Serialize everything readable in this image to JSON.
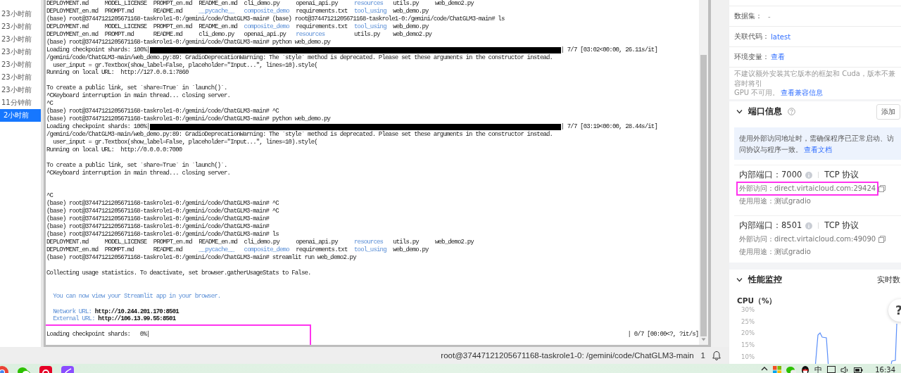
{
  "history": [
    {
      "label": "23小时前",
      "selected": false
    },
    {
      "label": "23小时前",
      "selected": false
    },
    {
      "label": "23小时前",
      "selected": false
    },
    {
      "label": "23小时前",
      "selected": false
    },
    {
      "label": "23小时前",
      "selected": false
    },
    {
      "label": "23小时前",
      "selected": false
    },
    {
      "label": "23小时前",
      "selected": false
    },
    {
      "label": "11分钟前",
      "selected": false
    },
    {
      "label": "2小时前",
      "selected": true
    }
  ],
  "terminal": {
    "lines": [
      {
        "kind": "ls",
        "entries": [
          {
            "name": "DEPLOYMENT.md",
            "kind": "file"
          },
          {
            "name": "MODEL_LICENSE",
            "kind": "file"
          },
          {
            "name": "PROMPT_en.md",
            "kind": "file"
          },
          {
            "name": "README_en.md",
            "kind": "file"
          },
          {
            "name": "cli_demo.py",
            "kind": "file"
          },
          {
            "name": "openai_api.py",
            "kind": "file"
          },
          {
            "name": "resources",
            "kind": "dir"
          },
          {
            "name": "utils.py",
            "kind": "file"
          },
          {
            "name": "web_demo2.py",
            "kind": "file"
          }
        ]
      },
      {
        "kind": "ls",
        "entries": [
          {
            "name": "DEPLOYMENT_en.md",
            "kind": "file"
          },
          {
            "name": "PROMPT.md",
            "kind": "file"
          },
          {
            "name": "README.md",
            "kind": "file"
          },
          {
            "name": "__pycache__",
            "kind": "dir"
          },
          {
            "name": "composite_demo",
            "kind": "dir"
          },
          {
            "name": "requirements.txt",
            "kind": "file"
          },
          {
            "name": "tool_using",
            "kind": "dir"
          },
          {
            "name": "web_demo.py",
            "kind": "file"
          }
        ]
      },
      {
        "kind": "text",
        "text": "(base) root@37447121205671168-taskrole1-0:/gemini/code/ChatGLM3-main# (base) root@37447121205671168-taskrole1-0:/gemini/code/ChatGLM3-main# ls"
      },
      {
        "kind": "ls",
        "entries": [
          {
            "name": "DEPLOYMENT.md",
            "kind": "file"
          },
          {
            "name": "MODEL_LICENSE",
            "kind": "file"
          },
          {
            "name": "PROMPT_en.md",
            "kind": "file"
          },
          {
            "name": "README_en.md",
            "kind": "file"
          },
          {
            "name": "composite_demo",
            "kind": "dir"
          },
          {
            "name": "requirements.txt",
            "kind": "file"
          },
          {
            "name": "tool_using",
            "kind": "dir"
          },
          {
            "name": "web_demo.py",
            "kind": "file"
          }
        ]
      },
      {
        "kind": "ls",
        "entries": [
          {
            "name": "DEPLOYMENT_en.md",
            "kind": "file"
          },
          {
            "name": "PROMPT.md",
            "kind": "file"
          },
          {
            "name": "README.md",
            "kind": "file"
          },
          {
            "name": "cli_demo.py",
            "kind": "file"
          },
          {
            "name": "openai_api.py",
            "kind": "file"
          },
          {
            "name": "resources",
            "kind": "dir"
          },
          {
            "name": "utils.py",
            "kind": "file"
          },
          {
            "name": "web_demo2.py",
            "kind": "file"
          }
        ]
      },
      {
        "kind": "text",
        "text": "(base) root@37447121205671168-taskrole1-0:/gemini/code/ChatGLM3-main# python web_demo.py"
      },
      {
        "kind": "progress",
        "label": "Loading checkpoint shards: 100%|",
        "level": 1,
        "stats": "| 7/7 [03:02<00:00, 26.11s/it]",
        "highlighted": false
      },
      {
        "kind": "text",
        "text": "/gemini/code/ChatGLM3-main/web_demo.py:89: GradioDeprecationWarning: The `style` method is deprecated. Please set these arguments in the constructor instead."
      },
      {
        "kind": "indented",
        "text": "user_input = gr.Textbox(show_label=False, placeholder=\"Input...\", lines=10).style("
      },
      {
        "kind": "text",
        "text": "Running on local URL:  http://127.0.0.1:7860"
      },
      {
        "kind": "blank"
      },
      {
        "kind": "text",
        "text": "To create a public link, set `share=True` in `launch()`."
      },
      {
        "kind": "text",
        "text": "^CKeyboard interruption in main thread... closing server."
      },
      {
        "kind": "text",
        "text": "^C"
      },
      {
        "kind": "text",
        "text": "(base) root@37447121205671168-taskrole1-0:/gemini/code/ChatGLM3-main# ^C"
      },
      {
        "kind": "text",
        "text": "(base) root@37447121205671168-taskrole1-0:/gemini/code/ChatGLM3-main# python web_demo.py"
      },
      {
        "kind": "progress",
        "label": "Loading checkpoint shards: 100%|",
        "level": 1,
        "stats": "| 7/7 [03:19<00:00, 28.44s/it]",
        "highlighted": false
      },
      {
        "kind": "text",
        "text": "/gemini/code/ChatGLM3-main/web_demo.py:89: GradioDeprecationWarning: The `style` method is deprecated. Please set these arguments in the constructor instead."
      },
      {
        "kind": "indented",
        "text": "user_input = gr.Textbox(show_label=False, placeholder=\"Input...\", lines=10).style("
      },
      {
        "kind": "text",
        "text": "Running on local URL:  http://0.0.0.0:7000"
      },
      {
        "kind": "blank"
      },
      {
        "kind": "text",
        "text": "To create a public link, set `share=True` in `launch()`."
      },
      {
        "kind": "text",
        "text": "^CKeyboard interruption in main thread... closing server."
      },
      {
        "kind": "blank"
      },
      {
        "kind": "blank"
      },
      {
        "kind": "text",
        "text": "^C"
      },
      {
        "kind": "text",
        "text": "(base) root@37447121205671168-taskrole1-0:/gemini/code/ChatGLM3-main# ^C"
      },
      {
        "kind": "text",
        "text": "(base) root@37447121205671168-taskrole1-0:/gemini/code/ChatGLM3-main# ^C"
      },
      {
        "kind": "text",
        "text": "(base) root@37447121205671168-taskrole1-0:/gemini/code/ChatGLM3-main#"
      },
      {
        "kind": "text",
        "text": "(base) root@37447121205671168-taskrole1-0:/gemini/code/ChatGLM3-main#"
      },
      {
        "kind": "text",
        "text": "(base) root@37447121205671168-taskrole1-0:/gemini/code/ChatGLM3-main# ls"
      },
      {
        "kind": "ls",
        "entries": [
          {
            "name": "DEPLOYMENT.md",
            "kind": "file"
          },
          {
            "name": "MODEL_LICENSE",
            "kind": "file"
          },
          {
            "name": "PROMPT_en.md",
            "kind": "file"
          },
          {
            "name": "README_en.md",
            "kind": "file"
          },
          {
            "name": "cli_demo.py",
            "kind": "file"
          },
          {
            "name": "openai_api.py",
            "kind": "file"
          },
          {
            "name": "resources",
            "kind": "dir"
          },
          {
            "name": "utils.py",
            "kind": "file"
          },
          {
            "name": "web_demo2.py",
            "kind": "file"
          }
        ]
      },
      {
        "kind": "ls",
        "entries": [
          {
            "name": "DEPLOYMENT_en.md",
            "kind": "file"
          },
          {
            "name": "PROMPT.md",
            "kind": "file"
          },
          {
            "name": "README.md",
            "kind": "file"
          },
          {
            "name": "__pycache__",
            "kind": "dir"
          },
          {
            "name": "composite_demo",
            "kind": "dir"
          },
          {
            "name": "requirements.txt",
            "kind": "file"
          },
          {
            "name": "tool_using",
            "kind": "dir"
          },
          {
            "name": "web_demo.py",
            "kind": "file"
          }
        ]
      },
      {
        "kind": "text",
        "text": "(base) root@37447121205671168-taskrole1-0:/gemini/code/ChatGLM3-main# streamlit run web_demo2.py"
      },
      {
        "kind": "blank"
      },
      {
        "kind": "text",
        "text": "Collecting usage statistics. To deactivate, set browser.gatherUsageStats to False."
      },
      {
        "kind": "blank"
      },
      {
        "kind": "blank"
      },
      {
        "kind": "notice",
        "text": "You can now view your Streamlit app in your browser."
      },
      {
        "kind": "blank"
      },
      {
        "kind": "url",
        "label": "Network URL:",
        "url": "http://10.244.201.170:8501"
      },
      {
        "kind": "url",
        "label": "External URL:",
        "url": "http://106.13.99.55:8501"
      },
      {
        "kind": "blank"
      },
      {
        "kind": "progress",
        "label": "Loading checkpoint shards:   0%|",
        "level": 0,
        "stats": "| 0/7 [00:00<?, ?it/s]",
        "highlighted": true
      }
    ]
  },
  "status_bar": {
    "text": "root@37447121205671168-taskrole1-0: /gemini/code/ChatGLM3-main",
    "count": "1"
  },
  "panel": {
    "fields": [
      {
        "label": "数据集：",
        "value": "-",
        "kind": "plain"
      },
      {
        "label": "关联代码：",
        "value": "latest",
        "kind": "link"
      },
      {
        "label": "环境变量：",
        "value": "查看",
        "kind": "link"
      }
    ],
    "note": {
      "lines": [
        "不建议额外安装其它版本的框架和 Cuda，版本不兼容时将引",
        "GPU 不可用。"
      ],
      "link": "查看兼容信息"
    },
    "ports_section": {
      "title": "端口信息",
      "expanded": true,
      "add_button": "添加",
      "notice": "使用外部访问地址时，需确保程序已正常启动、访问协议与程序一致。",
      "notice_link": "查看文档",
      "ports": [
        {
          "internal_label": "内部端口：",
          "port": "7000",
          "protocol": "TCP 协议",
          "external_label": "外部访问：",
          "external": "direct.virtaicloud.com:29424",
          "usage_label": "使用用途：",
          "usage": "测试gradio",
          "highlighted": true
        },
        {
          "internal_label": "内部端口：",
          "port": "8501",
          "protocol": "TCP 协议",
          "external_label": "外部访问：",
          "external": "direct.virtaicloud.com:49090",
          "usage_label": "使用用途：",
          "usage": "测试gradio",
          "highlighted": false
        }
      ]
    },
    "monitor_section": {
      "title": "性能监控",
      "expanded": true,
      "mode": "实时数",
      "cpu_chart": {
        "title": "CPU（%）",
        "axis_labels": [
          "30%",
          "25%",
          "20%",
          "15%",
          "10%"
        ]
      }
    },
    "help_button": "?"
  },
  "taskbar": {
    "input_method": "中",
    "time": "16:34"
  }
}
